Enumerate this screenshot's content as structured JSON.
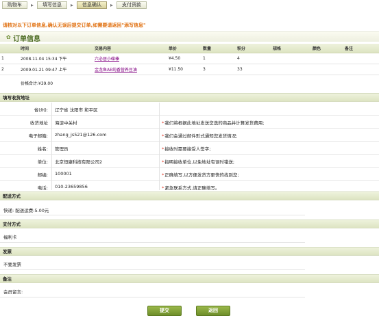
{
  "steps": [
    "购物车",
    "填写信息",
    "信息确认",
    "支付货款"
  ],
  "notice": "请核对以下订单信息,确认无误后提交订单,如需要请返回\"添写信息\"",
  "order_title": "订单信息",
  "order_table": {
    "headers": [
      "",
      "时间",
      "交易内容",
      "单价",
      "数量",
      "积分",
      "规格",
      "颜色",
      "备注"
    ],
    "rows": [
      {
        "no": "1",
        "time": "2008.11.04 15:34 下午",
        "item": "六必居小碟榛",
        "price": "¥4.50",
        "qty": "1",
        "points": "4",
        "spec": "",
        "color": "",
        "note": ""
      },
      {
        "no": "2",
        "time": "2009.01.21 09:47 上午",
        "item": "金龙鱼AE纯香营养豆油",
        "price": "¥11.50",
        "qty": "3",
        "points": "33",
        "spec": "",
        "color": "",
        "note": ""
      }
    ],
    "subtotal": "价格合计:¥39.00"
  },
  "address": {
    "section_title": "填写收货地址",
    "rows": [
      {
        "label": "省(州):",
        "value": "辽宁省  沈阳市  和平区",
        "tip": ""
      },
      {
        "label": "收货地址",
        "value": "海淀中关村",
        "tip": "我们将根据此地址发送您选的商品并计算发货费用;"
      },
      {
        "label": "电子邮箱:",
        "value": "zhang_js521@126.com",
        "tip": "我们会通过邮件形式通知您发货情况;"
      },
      {
        "label": "姓名:",
        "value": "管理员",
        "tip": "接收时需要接受人签字;"
      },
      {
        "label": "单位:",
        "value": "北京恒康科技有限公司2",
        "tip": "指明接收单位,以免地址有误时错送;"
      },
      {
        "label": "邮编:",
        "value": "100001",
        "tip": "正确填写,以方便发货方更快的找到您;"
      },
      {
        "label": "电话:",
        "value": "010-23659856",
        "tip": "紧急联系方式,请正确填写。"
      }
    ]
  },
  "delivery": {
    "title": "配送方式",
    "value": "快递:  配送运费:5.00元"
  },
  "payment": {
    "title": "支付方式",
    "value": "福利卡"
  },
  "invoice": {
    "title": "发票",
    "value": "不要发票"
  },
  "remarks": {
    "title": "备注",
    "label": "会员留言:",
    "value": ""
  },
  "buttons": {
    "submit": "提交",
    "back": "返回"
  }
}
